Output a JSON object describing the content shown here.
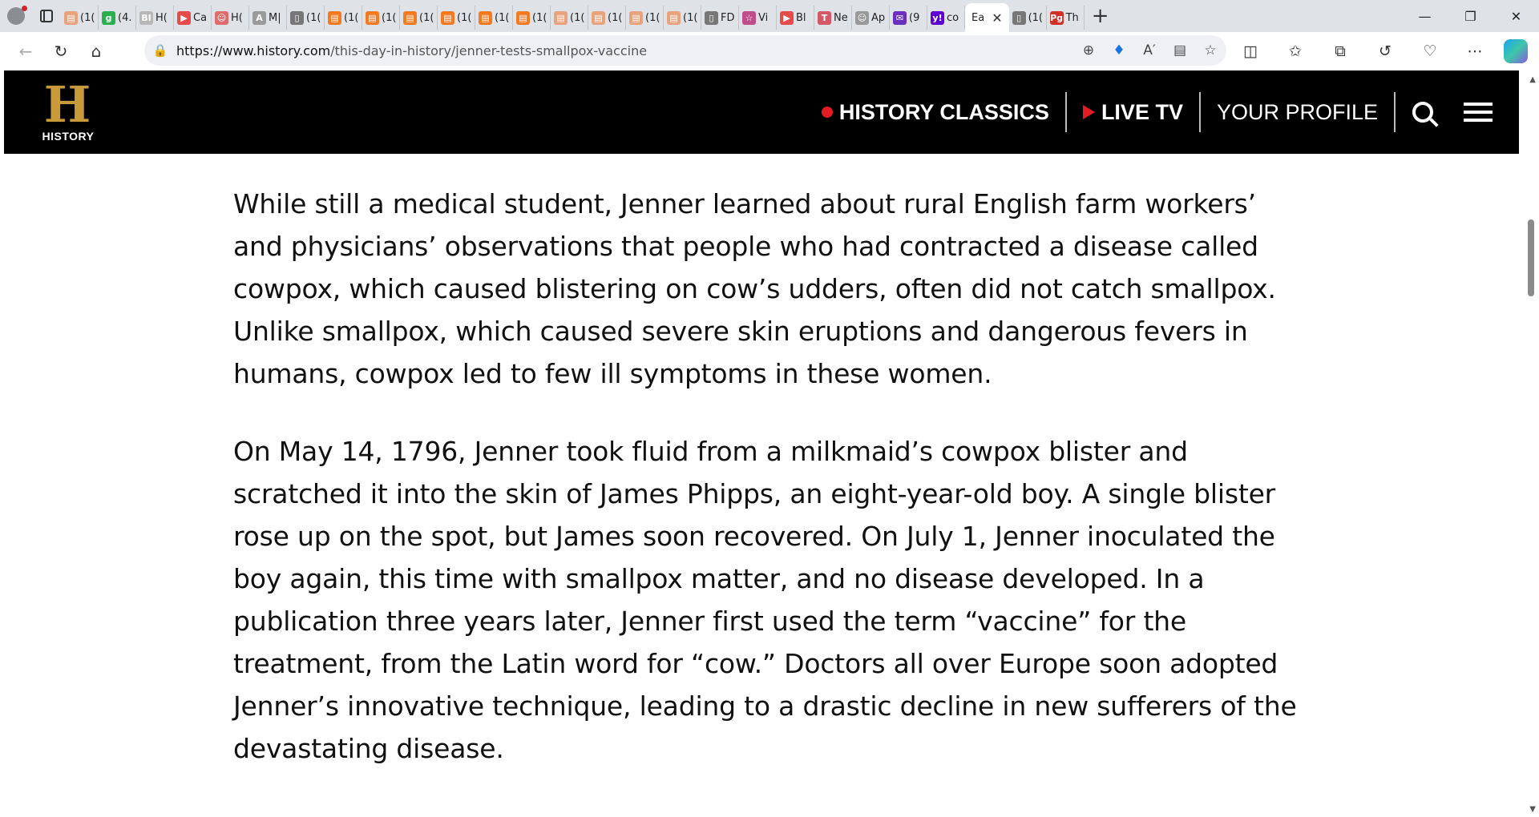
{
  "browser": {
    "tabs": [
      {
        "icon": "bookmark-icon",
        "color": "#e8a27c",
        "label": "(1("
      },
      {
        "icon": "g-icon",
        "color": "#28b04c",
        "label": "(4."
      },
      {
        "icon": "bi-icon",
        "color": "#b7b7b7",
        "label": "H("
      },
      {
        "icon": "video-icon",
        "color": "#e54b4b",
        "label": "Ca"
      },
      {
        "icon": "avatar-icon",
        "color": "#e06b6b",
        "label": "H("
      },
      {
        "icon": "font-icon",
        "color": "#9a9a9a",
        "label": "M|"
      },
      {
        "icon": "page-icon",
        "color": "#777777",
        "label": "(1("
      },
      {
        "icon": "bookmark-icon",
        "color": "#f47a20",
        "label": "(1("
      },
      {
        "icon": "bookmark-icon",
        "color": "#f47a20",
        "label": "(1("
      },
      {
        "icon": "bookmark-icon",
        "color": "#f47a20",
        "label": "(1("
      },
      {
        "icon": "bookmark-icon",
        "color": "#f47a20",
        "label": "(1("
      },
      {
        "icon": "bookmark-icon",
        "color": "#f47a20",
        "label": "(1("
      },
      {
        "icon": "bookmark-icon",
        "color": "#f47a20",
        "label": "(1("
      },
      {
        "icon": "bookmark-icon",
        "color": "#e8a27c",
        "label": "(1("
      },
      {
        "icon": "bookmark-icon",
        "color": "#e8a27c",
        "label": "(1("
      },
      {
        "icon": "bookmark-icon",
        "color": "#e8a27c",
        "label": "(1("
      },
      {
        "icon": "bookmark-icon",
        "color": "#e8a27c",
        "label": "(1("
      },
      {
        "icon": "page-icon",
        "color": "#777777",
        "label": "FD"
      },
      {
        "icon": "star-icon",
        "color": "#c04c8c",
        "label": "Vi"
      },
      {
        "icon": "video-icon",
        "color": "#e54b4b",
        "label": "Bl"
      },
      {
        "icon": "t-icon",
        "color": "#d2586a",
        "label": "Ne"
      },
      {
        "icon": "avatar-icon",
        "color": "#999999",
        "label": "Ap"
      },
      {
        "icon": "mail-icon",
        "color": "#6b2fc0",
        "label": "(9"
      },
      {
        "icon": "yahoo-icon",
        "color": "#5f01d1",
        "label": "co"
      }
    ],
    "active_tab": {
      "label": "Ea"
    },
    "after_tabs": [
      {
        "icon": "page-icon",
        "color": "#777777",
        "label": "(1("
      },
      {
        "icon": "pg-icon",
        "color": "#d22f27",
        "label": "Th"
      }
    ],
    "url_host": "https://www.history.com",
    "url_path": "/this-day-in-history/jenner-tests-smallpox-vaccine"
  },
  "site": {
    "logo_letter": "H",
    "logo_word": "HISTORY",
    "nav": {
      "classics": "HISTORY CLASSICS",
      "live_tv": "LIVE TV",
      "profile": "YOUR PROFILE"
    }
  },
  "article": {
    "paragraphs": [
      "While still a medical student, Jenner learned about rural English farm workers’ and physicians’ observations that people who had contracted a disease called cowpox, which caused blistering on cow’s udders, often did not catch smallpox. Unlike smallpox, which caused severe skin eruptions and dangerous fevers in humans, cowpox led to few ill symptoms in these women.",
      "On May 14, 1796, Jenner took fluid from a milkmaid’s cowpox blister and scratched it into the skin of James Phipps, an eight-year-old boy. A single blister rose up on the spot, but James soon recovered. On July 1, Jenner inoculated the boy again, this time with smallpox matter, and no disease developed. In a publication three years later, Jenner first used the term “vaccine” for the treatment, from the Latin word for “cow.” Doctors all over Europe soon adopted Jenner’s innovative technique, leading to a drastic decline in new sufferers of the devastating disease."
    ]
  },
  "colors": {
    "header_bg": "#000000",
    "accent_red": "#e31b23",
    "logo_gold": "#c99a3a"
  }
}
